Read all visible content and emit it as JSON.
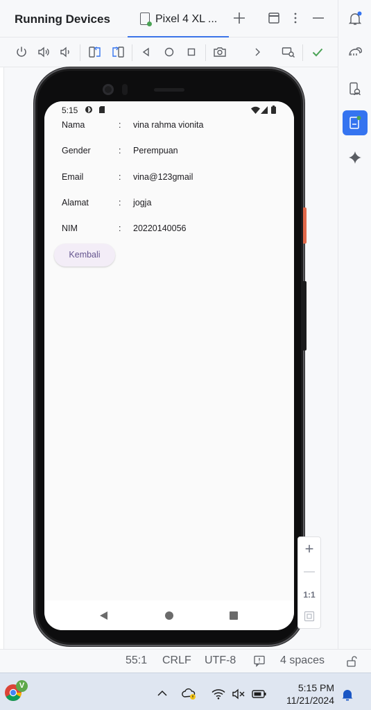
{
  "panel": {
    "title": "Running Devices",
    "device_tab": "Pixel 4 XL ..."
  },
  "phone": {
    "status_time": "5:15",
    "fields": [
      {
        "label": "Nama",
        "colon": ":",
        "value": "vina rahma vionita"
      },
      {
        "label": "Gender",
        "colon": ":",
        "value": "Perempuan"
      },
      {
        "label": "Email",
        "colon": ":",
        "value": "vina@123gmail"
      },
      {
        "label": "Alamat",
        "colon": ":",
        "value": "jogja"
      },
      {
        "label": "NIM",
        "colon": ":",
        "value": "20220140056"
      }
    ],
    "back_button": "Kembali"
  },
  "zoom": {
    "in": "+",
    "out": "—",
    "actual": "1:1"
  },
  "ide_status": {
    "position": "55:1",
    "line_sep": "CRLF",
    "encoding": "UTF-8",
    "indent": "4 spaces"
  },
  "taskbar": {
    "time": "5:15 PM",
    "date": "11/21/2024",
    "chrome_avatar": "V"
  },
  "colors": {
    "accent": "#3574f0",
    "app_button_bg": "#f3edf7",
    "app_button_text": "#65558f",
    "status_ok": "#4aa255"
  }
}
